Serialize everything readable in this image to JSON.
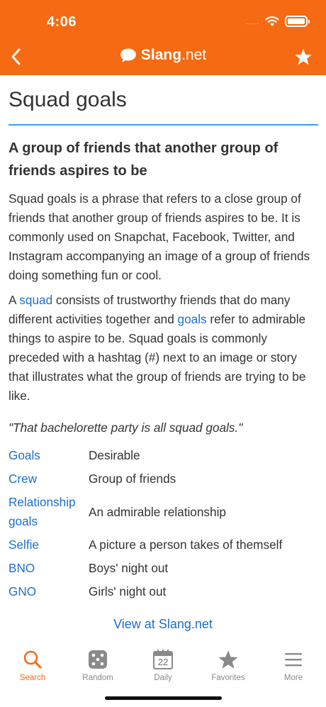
{
  "status_bar": {
    "time": "4:06",
    "signal": "....."
  },
  "nav": {
    "brand_bold": "Slang",
    "brand_suffix": ".net"
  },
  "term": {
    "title": "Squad goals",
    "definition_heading": "A group of friends that another group of friends aspires to be",
    "paragraph1": "Squad goals is a phrase that refers to a close group of friends that another group of friends aspires to be. It is commonly used on Snapchat, Facebook, Twitter, and Instagram accompanying an image of a group of friends doing something fun or cool.",
    "paragraph2": {
      "p1": "A ",
      "link1": "squad",
      "p2": " consists of trustworthy friends that do many different activities together and ",
      "link2": "goals",
      "p3": " refer to admirable things to aspire to be. Squad goals is commonly preceded with a hashtag (#) next to an image or story that illustrates what the group of friends are trying to be like."
    },
    "example": "\"That bachelorette party is all squad goals.\""
  },
  "related": [
    {
      "term": "Goals",
      "meaning": "Desirable"
    },
    {
      "term": "Crew",
      "meaning": "Group of friends"
    },
    {
      "term": "Relationship goals",
      "meaning": "An admirable relationship"
    },
    {
      "term": "Selfie",
      "meaning": "A picture a person takes of themself"
    },
    {
      "term": "BNO",
      "meaning": "Boys' night out"
    },
    {
      "term": "GNO",
      "meaning": "Girls' night out"
    }
  ],
  "view_link": "View at Slang.net",
  "tabs": [
    {
      "label": "Search",
      "icon": "search-icon",
      "active": true
    },
    {
      "label": "Random",
      "icon": "dice-icon",
      "active": false
    },
    {
      "label": "Daily",
      "icon": "calendar-icon",
      "active": false,
      "date": "22"
    },
    {
      "label": "Favorites",
      "icon": "star-icon",
      "active": false
    },
    {
      "label": "More",
      "icon": "menu-icon",
      "active": false
    }
  ],
  "colors": {
    "header": "#f56a12",
    "accent_link": "#1f6fd1",
    "rule": "#3b9ee6"
  }
}
